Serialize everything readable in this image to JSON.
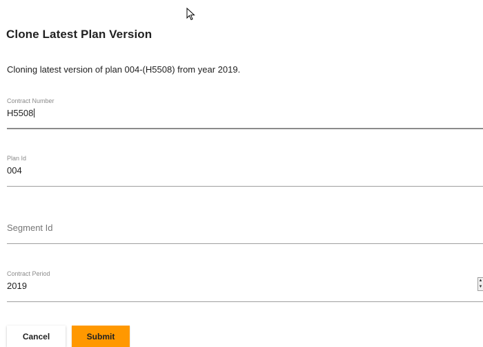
{
  "dialog": {
    "title": "Clone Latest Plan Version",
    "description": "Cloning latest version of plan 004-(H5508) from year 2019."
  },
  "fields": {
    "contract_number": {
      "label": "Contract Number",
      "value": "H5508"
    },
    "plan_id": {
      "label": "Plan Id",
      "value": "004"
    },
    "segment_id": {
      "label": "Segment Id",
      "value": ""
    },
    "contract_period": {
      "label": "Contract Period",
      "value": "2019"
    }
  },
  "buttons": {
    "cancel_label": "Cancel",
    "submit_label": "Submit"
  },
  "colors": {
    "accent": "#ff9800",
    "underline": "#9e9e9e",
    "label": "#8a8a8a"
  },
  "icons": {
    "cursor": "mouse-pointer-icon",
    "spinner": "number-spinner-icon"
  }
}
